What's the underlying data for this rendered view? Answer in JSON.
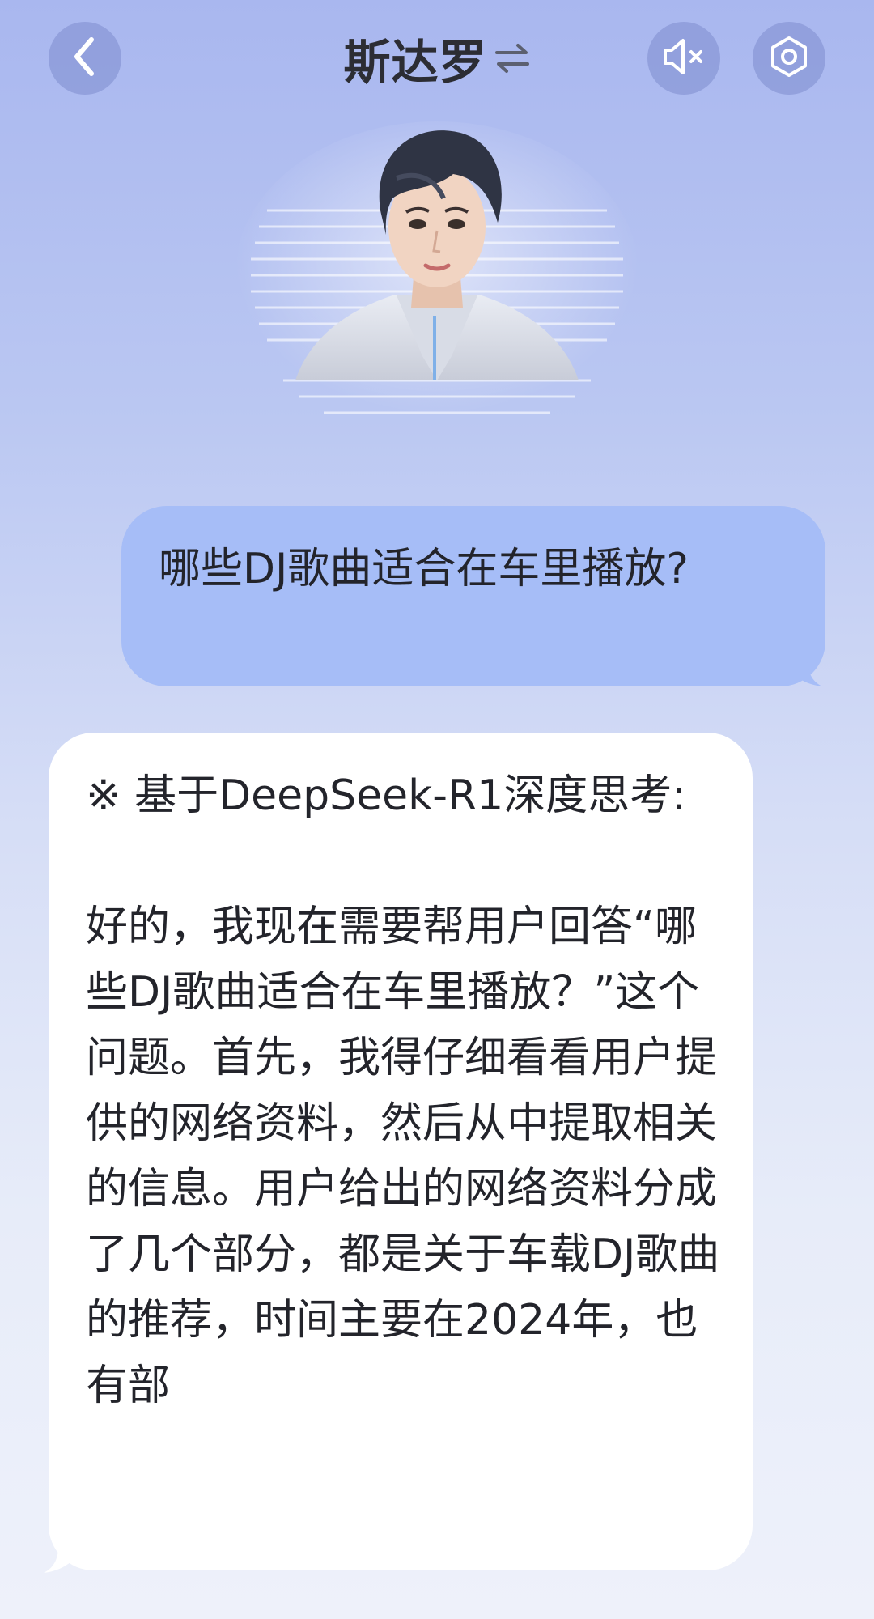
{
  "header": {
    "title": "斯达罗",
    "back_icon": "chevron-left-icon",
    "swap_icon": "swap-arrows-icon",
    "mute_icon": "speaker-muted-icon",
    "settings_icon": "hexagon-settings-icon"
  },
  "avatar": {
    "icon": "character-avatar"
  },
  "chat": {
    "user_message": "哪些DJ歌曲适合在车里播放?",
    "ai_header": "※ 基于DeepSeek-R1深度思考:",
    "ai_body": "好的，我现在需要帮用户回答“哪些DJ歌曲适合在车里播放？”这个问题。首先，我得仔细看看用户提供的网络资料，然后从中提取相关的信息。用户给出的网络资料分成了几个部分，都是关于车载DJ歌曲的推荐，时间主要在2024年，也有部"
  },
  "colors": {
    "user_bubble": "#a6bdf7",
    "ai_bubble": "#ffffff",
    "header_button": "#7d8ccd"
  }
}
